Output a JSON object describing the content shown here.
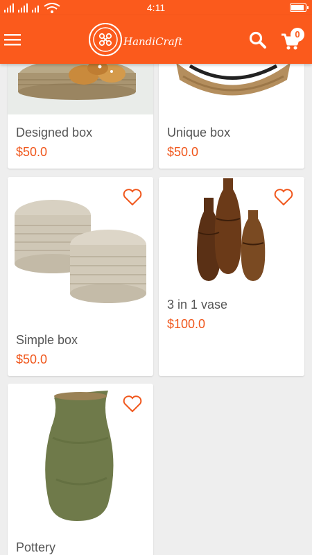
{
  "status_bar": {
    "time": "4:11"
  },
  "app_bar": {
    "brand": "HandiCraft",
    "cart_count": "0"
  },
  "products": [
    {
      "name": "Designed box",
      "price": "$50.0"
    },
    {
      "name": "Unique box",
      "price": "$50.0"
    },
    {
      "name": "Simple box",
      "price": "$50.0"
    },
    {
      "name": "3 in 1 vase",
      "price": "$100.0"
    },
    {
      "name": "Pottery",
      "price": ""
    }
  ],
  "colors": {
    "accent": "#fb5a1c",
    "price": "#f0561b",
    "background": "#eeeeee"
  },
  "icons": [
    "menu-icon",
    "logo-icon",
    "search-icon",
    "cart-icon",
    "heart-icon",
    "signal-icon",
    "wifi-icon",
    "battery-icon"
  ]
}
